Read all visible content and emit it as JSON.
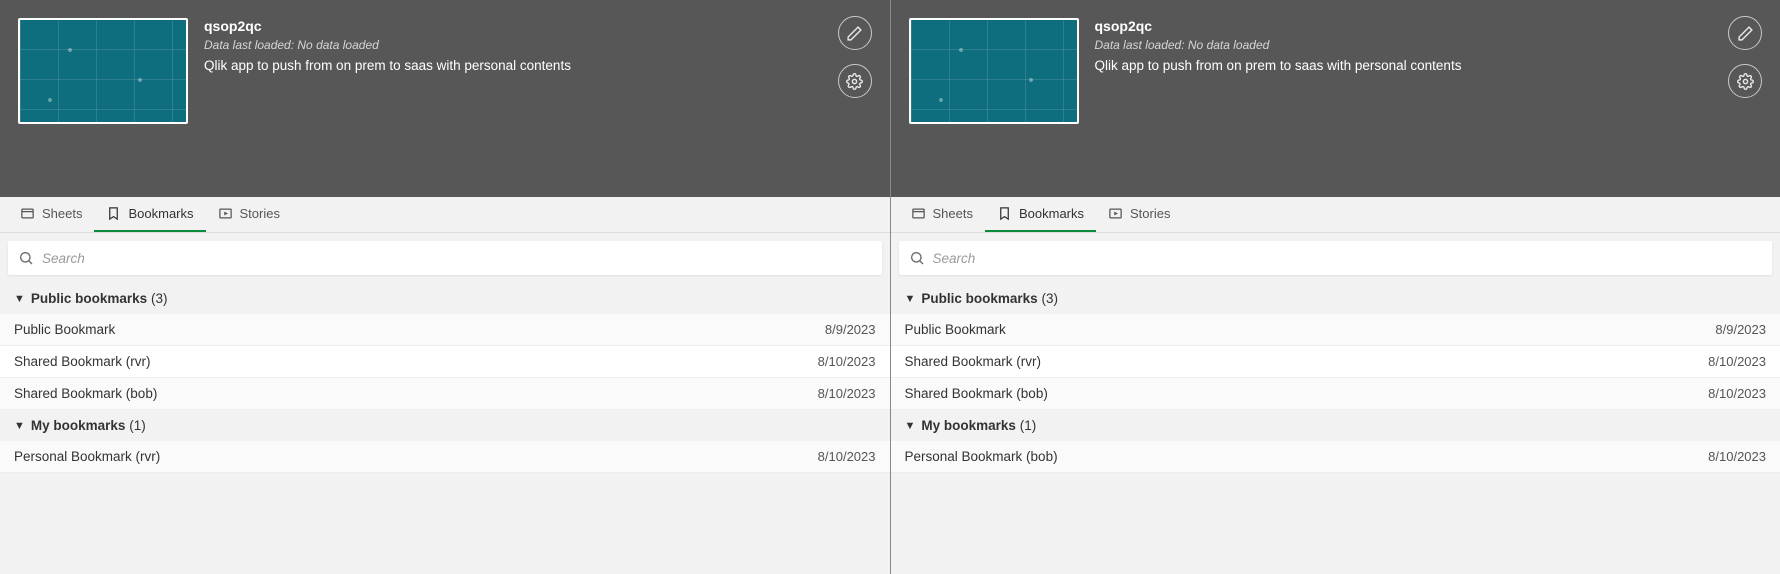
{
  "tabs": {
    "sheets": "Sheets",
    "bookmarks": "Bookmarks",
    "stories": "Stories"
  },
  "search": {
    "placeholder": "Search"
  },
  "panels": [
    {
      "app": {
        "title": "qsop2qc",
        "subtitle": "Data last loaded: No data loaded",
        "desc": "Qlik app to push from on prem to saas with personal contents"
      },
      "sections": [
        {
          "title": "Public bookmarks",
          "count": "(3)",
          "items": [
            {
              "label": "Public Bookmark",
              "date": "8/9/2023"
            },
            {
              "label": "Shared Bookmark (rvr)",
              "date": "8/10/2023"
            },
            {
              "label": "Shared Bookmark (bob)",
              "date": "8/10/2023"
            }
          ]
        },
        {
          "title": "My bookmarks",
          "count": "(1)",
          "items": [
            {
              "label": "Personal Bookmark (rvr)",
              "date": "8/10/2023"
            }
          ]
        }
      ]
    },
    {
      "app": {
        "title": "qsop2qc",
        "subtitle": "Data last loaded: No data loaded",
        "desc": "Qlik app to push from on prem to saas with personal contents"
      },
      "sections": [
        {
          "title": "Public bookmarks",
          "count": "(3)",
          "items": [
            {
              "label": "Public Bookmark",
              "date": "8/9/2023"
            },
            {
              "label": "Shared Bookmark (rvr)",
              "date": "8/10/2023"
            },
            {
              "label": "Shared Bookmark (bob)",
              "date": "8/10/2023"
            }
          ]
        },
        {
          "title": "My bookmarks",
          "count": "(1)",
          "items": [
            {
              "label": "Personal Bookmark (bob)",
              "date": "8/10/2023"
            }
          ]
        }
      ]
    }
  ]
}
